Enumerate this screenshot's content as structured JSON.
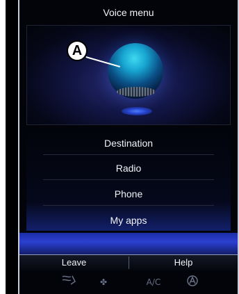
{
  "header": {
    "title": "Voice menu"
  },
  "callout": {
    "label": "A"
  },
  "menu": {
    "items": [
      "Destination",
      "Radio",
      "Phone",
      "My apps"
    ]
  },
  "footer": {
    "leave_label": "Leave",
    "help_label": "Help",
    "icons": {
      "seat": "seat-icon",
      "fan": "fan-icon",
      "ac": "A/C",
      "auto": "auto-climate-icon"
    }
  },
  "colors": {
    "background": "#02040a",
    "accent": "#2b3fd0",
    "text": "#f1f3f8"
  }
}
